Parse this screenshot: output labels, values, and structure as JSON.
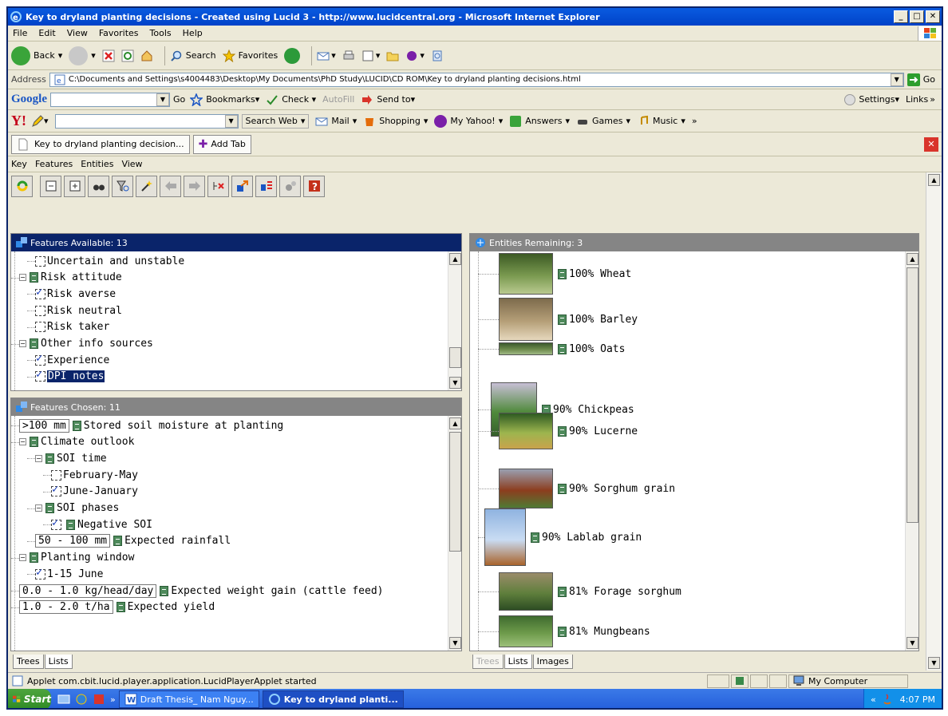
{
  "window": {
    "title": "Key to dryland planting decisions - Created using Lucid 3 - http://www.lucidcentral.org - Microsoft Internet Explorer",
    "minimize": "_",
    "maximize": "□",
    "close": "✕"
  },
  "menu": [
    "File",
    "Edit",
    "View",
    "Favorites",
    "Tools",
    "Help"
  ],
  "toolbar": {
    "back": "Back",
    "search": "Search",
    "favorites": "Favorites"
  },
  "address": {
    "label": "Address",
    "value": "C:\\Documents and Settings\\s4004483\\Desktop\\My Documents\\PhD Study\\LUCID\\CD ROM\\Key to dryland planting decisions.html",
    "go": "Go"
  },
  "google": {
    "logo": "Google",
    "go": "Go",
    "bookmarks": "Bookmarks▾",
    "check": "Check ▾",
    "autofill": "AutoFill",
    "sendto": "Send to▾",
    "settings": "Settings▾",
    "links": "Links"
  },
  "yahoo": {
    "logo": "Y!",
    "search_web": "Search Web",
    "mail": "Mail",
    "shopping": "Shopping",
    "myyahoo": "My Yahoo!",
    "answers": "Answers",
    "games": "Games",
    "music": "Music"
  },
  "tabs": {
    "current": "Key to dryland planting decision...",
    "add": "Add Tab"
  },
  "appmenu": [
    "Key",
    "Features",
    "Entities",
    "View"
  ],
  "features_available": {
    "header": "Features Available: 13",
    "items": [
      {
        "label": "Uncertain and unstable",
        "type": "state",
        "checked": false,
        "level": 2
      },
      {
        "label": "Risk attitude",
        "type": "group",
        "level": 1
      },
      {
        "label": "Risk averse",
        "type": "state",
        "checked": true,
        "level": 2
      },
      {
        "label": "Risk neutral",
        "type": "state",
        "checked": false,
        "level": 2
      },
      {
        "label": "Risk taker",
        "type": "state",
        "checked": false,
        "level": 2
      },
      {
        "label": "Other info sources",
        "type": "group",
        "level": 1
      },
      {
        "label": "Experience",
        "type": "state",
        "checked": true,
        "level": 2
      },
      {
        "label": "DPI notes",
        "type": "state",
        "checked": true,
        "level": 2,
        "selected": true
      }
    ]
  },
  "features_chosen": {
    "header": "Features Chosen: 11",
    "items": [
      {
        "value": ">100 mm",
        "label": "Stored soil moisture at planting",
        "type": "numeric",
        "level": 1
      },
      {
        "label": "Climate outlook",
        "type": "group",
        "level": 1
      },
      {
        "label": "SOI time",
        "type": "group",
        "level": 2
      },
      {
        "label": "February-May",
        "type": "state",
        "checked": false,
        "level": 3
      },
      {
        "label": "June-January",
        "type": "state",
        "checked": true,
        "level": 3
      },
      {
        "label": "SOI phases",
        "type": "group",
        "level": 2
      },
      {
        "label": "Negative SOI",
        "type": "state-note",
        "checked": true,
        "level": 3
      },
      {
        "value": "50 - 100 mm",
        "label": "Expected rainfall",
        "type": "numeric",
        "level": 2
      },
      {
        "label": "Planting window",
        "type": "group",
        "level": 1
      },
      {
        "label": "1-15 June",
        "type": "state",
        "checked": true,
        "level": 2
      },
      {
        "value": "0.0 - 1.0 kg/head/day",
        "label": "Expected weight gain (cattle feed)",
        "type": "numeric",
        "level": 1
      },
      {
        "value": "1.0 - 2.0 t/ha",
        "label": "Expected yield",
        "type": "numeric",
        "level": 1
      }
    ],
    "tabs": [
      "Trees",
      "Lists"
    ]
  },
  "entities": {
    "header": "Entities Remaining: 3",
    "items": [
      {
        "label": "100% Wheat",
        "colors": [
          "#3c5a24",
          "#7a9a50",
          "#b9c98f"
        ]
      },
      {
        "label": "100% Barley",
        "colors": [
          "#7d6b4c",
          "#b59f78",
          "#e6d8bd"
        ]
      },
      {
        "label": "100% Oats",
        "colors": [
          "#3d5a2e",
          "#6d8b4d",
          "#a0b985"
        ]
      },
      {
        "label": "90% Chickpeas",
        "colors": [
          "#c7bfd5",
          "#4f8a3b",
          "#355f2a"
        ]
      },
      {
        "label": "90% Lucerne",
        "colors": [
          "#2e5a22",
          "#9cb54e",
          "#c9a34c"
        ]
      },
      {
        "label": "90% Sorghum grain",
        "colors": [
          "#9a9fb0",
          "#8c3d1e",
          "#4f7a33"
        ]
      },
      {
        "label": "90% Lablab grain",
        "colors": [
          "#8fb3e0",
          "#c9dcf3",
          "#a9642c"
        ]
      },
      {
        "label": "81% Forage sorghum",
        "colors": [
          "#9a8c6a",
          "#5f7f3c",
          "#2d4d23"
        ]
      },
      {
        "label": "81% Mungbeans",
        "colors": [
          "#3f6b2f",
          "#6d9a4a",
          "#9cc07a"
        ]
      }
    ],
    "tabs": [
      "Trees",
      "Lists",
      "Images"
    ]
  },
  "status": {
    "text": "Applet com.cbit.lucid.player.application.LucidPlayerApplet started",
    "zone": "My Computer"
  },
  "taskbar": {
    "start": "Start",
    "tasks": [
      "Draft Thesis_ Nam Nguy...",
      "Key to dryland planti..."
    ],
    "time": "4:07 PM"
  },
  "colors": {
    "chosen_header": "#0a246a",
    "inactive_header": "#858585",
    "selection": "#0a246a"
  }
}
